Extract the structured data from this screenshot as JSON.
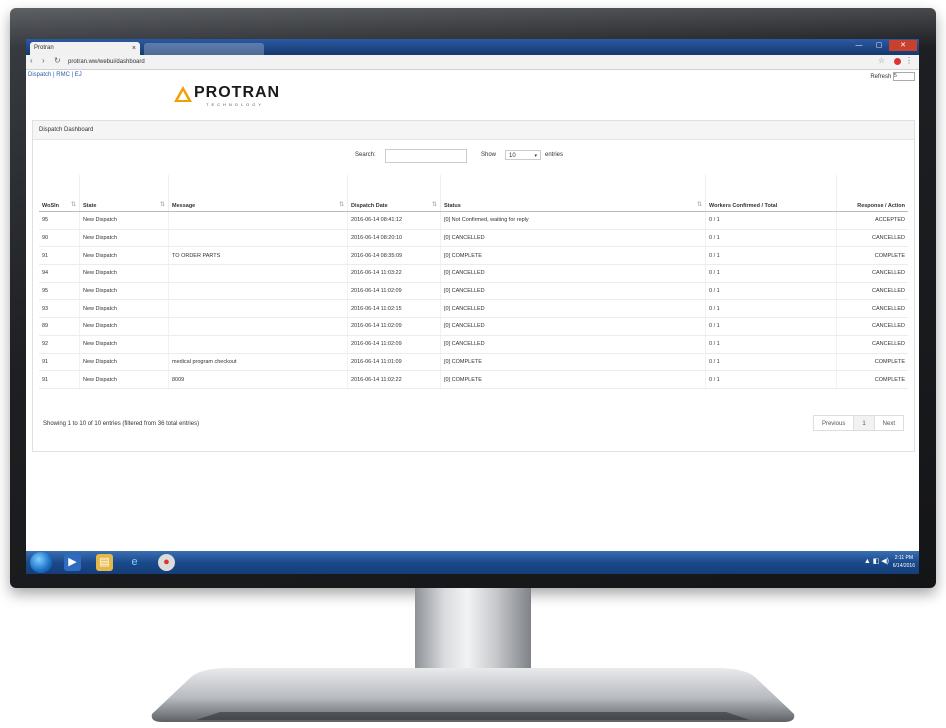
{
  "browser": {
    "tab_title": "Protran",
    "tab_close": "×",
    "url": "protran.ww/webui/dashboard",
    "window_controls": [
      "—",
      "▢",
      "✕"
    ]
  },
  "page": {
    "top_links": "Dispatch | RMC | EJ",
    "refresh_label": "Refresh",
    "refresh_value": "5",
    "logo_text": "PROTRAN",
    "logo_sub": "TECHNOLOGY",
    "panel_title": "Dispatch Dashboard",
    "search_label": "Search:",
    "show_label": "Show",
    "show_value": "10",
    "entries_label": "entries"
  },
  "table": {
    "headers": {
      "id": "WoSIn",
      "state": "State",
      "message": "Message",
      "date": "Dispatch Date",
      "status": "Status",
      "workers": "Workers Confirmed / Total",
      "response": "Response / Action"
    },
    "rows": [
      {
        "id": "95",
        "state": "New Dispatch",
        "message": "",
        "date": "2016-06-14 08:41:12",
        "status": "[0] Not Confirmed, waiting for reply",
        "workers": "0 / 1",
        "response": "ACCEPTED"
      },
      {
        "id": "90",
        "state": "New Dispatch",
        "message": "",
        "date": "2016-06-14 08:20:10",
        "status": "[0] CANCELLED",
        "workers": "0 / 1",
        "response": "CANCELLED"
      },
      {
        "id": "91",
        "state": "New Dispatch",
        "message": "TO ORDER PARTS",
        "date": "2016-06-14 08:35:09",
        "status": "[0] COMPLETE",
        "workers": "0 / 1",
        "response": "COMPLETE"
      },
      {
        "id": "94",
        "state": "New Dispatch",
        "message": "",
        "date": "2016-06-14 11:03:22",
        "status": "[0] CANCELLED",
        "workers": "0 / 1",
        "response": "CANCELLED"
      },
      {
        "id": "95",
        "state": "New Dispatch",
        "message": "",
        "date": "2016-06-14 11:02:09",
        "status": "[0] CANCELLED",
        "workers": "0 / 1",
        "response": "CANCELLED"
      },
      {
        "id": "93",
        "state": "New Dispatch",
        "message": "",
        "date": "2016-06-14 11:02:15",
        "status": "[0] CANCELLED",
        "workers": "0 / 1",
        "response": "CANCELLED"
      },
      {
        "id": "89",
        "state": "New Dispatch",
        "message": "",
        "date": "2016-06-14 11:02:09",
        "status": "[0] CANCELLED",
        "workers": "0 / 1",
        "response": "CANCELLED"
      },
      {
        "id": "92",
        "state": "New Dispatch",
        "message": "",
        "date": "2016-06-14 11:02:09",
        "status": "[0] CANCELLED",
        "workers": "0 / 1",
        "response": "CANCELLED"
      },
      {
        "id": "91",
        "state": "New Dispatch",
        "message": "medical program checkout",
        "date": "2016-06-14 11:01:09",
        "status": "[0] COMPLETE",
        "workers": "0 / 1",
        "response": "COMPLETE"
      },
      {
        "id": "91",
        "state": "New Dispatch",
        "message": "8009",
        "date": "2016-06-14 11:02:22",
        "status": "[0] COMPLETE",
        "workers": "0 / 1",
        "response": "COMPLETE"
      }
    ],
    "info": "Showing 1 to 10 of 10 entries (filtered from 36 total entries)",
    "pager": {
      "previous": "Previous",
      "page": "1",
      "next": "Next"
    }
  },
  "taskbar": {
    "tray": "▲ ◧ ◀)",
    "time": "2:11 PM",
    "date": "6/14/2016"
  }
}
